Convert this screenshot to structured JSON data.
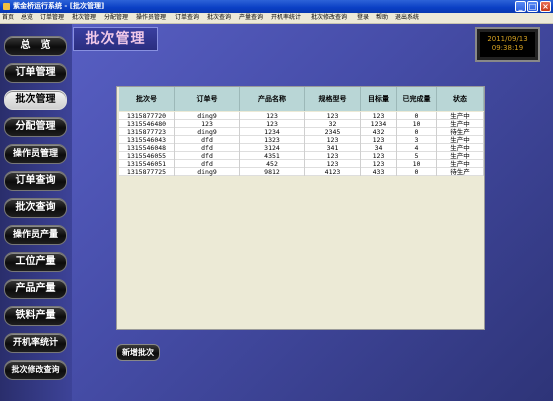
{
  "window": {
    "title": "紫金桥运行系统 - [批次管理]"
  },
  "menu": [
    "首页",
    "总览",
    "订单管理",
    "批次管理",
    "分配管理",
    "操作员管理",
    "订单查询",
    "批次查询",
    "产量查询",
    "开机率统计",
    "批次修改查询",
    "登录",
    "帮助",
    "退出系统"
  ],
  "nav": [
    "总　览",
    "订单管理",
    "批次管理",
    "分配管理",
    "操作员管理",
    "订单查询",
    "批次查询",
    "操作员产量",
    "工位产量",
    "产品产量",
    "铁料产量",
    "开机率统计",
    "批次修改查询"
  ],
  "page_title": "批次管理",
  "clock": {
    "date": "2011/09/13",
    "time": "09:38:19"
  },
  "table": {
    "columns": [
      "批次号",
      "订单号",
      "产品名称",
      "规格型号",
      "目标量",
      "已完成量",
      "状态"
    ],
    "rows": [
      [
        "1315877720",
        "ding9",
        "123",
        "123",
        "123",
        "0",
        "生产中"
      ],
      [
        "1315546480",
        "123",
        "123",
        "32",
        "1234",
        "10",
        "生产中"
      ],
      [
        "1315877723",
        "ding9",
        "1234",
        "2345",
        "432",
        "0",
        "待生产"
      ],
      [
        "1315546043",
        "dfd",
        "1323",
        "123",
        "123",
        "3",
        "生产中"
      ],
      [
        "1315546048",
        "dfd",
        "3124",
        "341",
        "34",
        "4",
        "生产中"
      ],
      [
        "1315546055",
        "dfd",
        "4351",
        "123",
        "123",
        "5",
        "生产中"
      ],
      [
        "1315546051",
        "dfd",
        "452",
        "123",
        "123",
        "10",
        "生产中"
      ],
      [
        "1315877725",
        "ding9",
        "9812",
        "4123",
        "433",
        "0",
        "待生产"
      ]
    ]
  },
  "new_batch_label": "新增批次"
}
